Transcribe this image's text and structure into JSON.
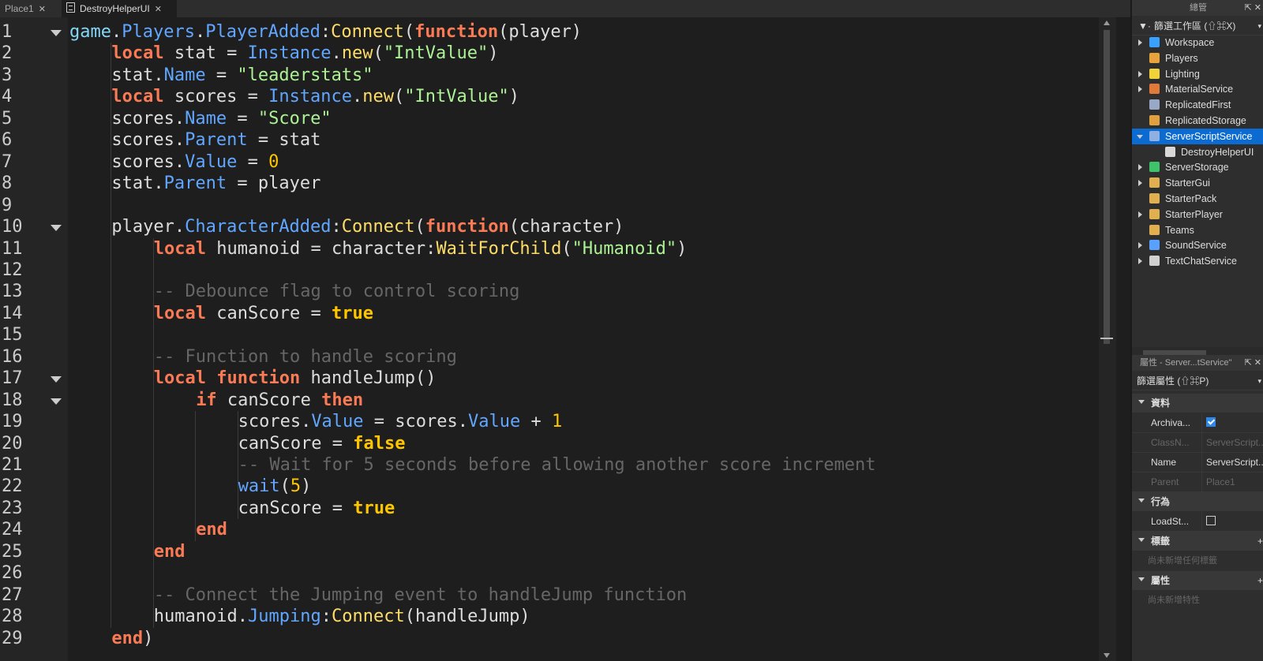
{
  "tabs": [
    {
      "label": "Place1",
      "active": false
    },
    {
      "label": "DestroyHelperUI",
      "active": true
    }
  ],
  "editor": {
    "line_numbers": [
      "1",
      "2",
      "3",
      "4",
      "5",
      "6",
      "7",
      "8",
      "9",
      "10",
      "11",
      "12",
      "13",
      "14",
      "15",
      "16",
      "17",
      "18",
      "19",
      "20",
      "21",
      "22",
      "23",
      "24",
      "25",
      "26",
      "27",
      "28",
      "29"
    ],
    "code": {
      "l1": [
        "game",
        ".",
        "Players",
        ".",
        "PlayerAdded",
        ":",
        "Connect",
        "(",
        "function",
        "(player)"
      ],
      "l2": [
        "local",
        " stat = ",
        "Instance",
        ".",
        "new",
        "(",
        "\"IntValue\"",
        ")"
      ],
      "l3": [
        "stat.",
        "Name",
        " = ",
        "\"leaderstats\""
      ],
      "l4": [
        "local",
        " scores = ",
        "Instance",
        ".",
        "new",
        "(",
        "\"IntValue\"",
        ")"
      ],
      "l5": [
        "scores.",
        "Name",
        " = ",
        "\"Score\""
      ],
      "l6": [
        "scores.",
        "Parent",
        " = stat"
      ],
      "l7": [
        "scores.",
        "Value",
        " = ",
        "0"
      ],
      "l8": [
        "stat.",
        "Parent",
        " = player"
      ],
      "l10": [
        "player.",
        "CharacterAdded",
        ":",
        "Connect",
        "(",
        "function",
        "(character)"
      ],
      "l11": [
        "local",
        " humanoid = character:",
        "WaitForChild",
        "(",
        "\"Humanoid\"",
        ")"
      ],
      "l13": [
        "-- Debounce flag to control scoring"
      ],
      "l14": [
        "local",
        " canScore = ",
        "true"
      ],
      "l16": [
        "-- Function to handle scoring"
      ],
      "l17": [
        "local",
        " ",
        "function",
        " handleJump()"
      ],
      "l18": [
        "if",
        " canScore ",
        "then"
      ],
      "l19": [
        "scores.",
        "Value",
        " = scores.",
        "Value",
        " + ",
        "1"
      ],
      "l20": [
        "canScore = ",
        "false"
      ],
      "l21": [
        "-- Wait for 5 seconds before allowing another score increment"
      ],
      "l22": [
        "wait",
        "(",
        "5",
        ")"
      ],
      "l23": [
        "canScore = ",
        "true"
      ],
      "l24": [
        "end"
      ],
      "l25": [
        "end"
      ],
      "l27": [
        "-- Connect the Jumping event to handleJump function"
      ],
      "l28": [
        "humanoid.",
        "Jumping",
        ":",
        "Connect",
        "(handleJump)"
      ],
      "l29": [
        "end",
        ")"
      ]
    }
  },
  "explorer": {
    "title": "總管",
    "filter": "篩選工作區 (⇧⌘X)",
    "items": [
      {
        "label": "Workspace",
        "color": "#3aa0ff"
      },
      {
        "label": "Players",
        "color": "#e8a33a"
      },
      {
        "label": "Lighting",
        "color": "#f2d23a"
      },
      {
        "label": "MaterialService",
        "color": "#e07a3a"
      },
      {
        "label": "ReplicatedFirst",
        "color": "#9aa8c8"
      },
      {
        "label": "ReplicatedStorage",
        "color": "#e0a040"
      },
      {
        "label": "ServerScriptService",
        "color": "#8fb0e0"
      },
      {
        "label": "DestroyHelperUI",
        "color": "#d8d8d8"
      },
      {
        "label": "ServerStorage",
        "color": "#3ec36a"
      },
      {
        "label": "StarterGui",
        "color": "#e0b050"
      },
      {
        "label": "StarterPack",
        "color": "#e0b050"
      },
      {
        "label": "StarterPlayer",
        "color": "#e0b050"
      },
      {
        "label": "Teams",
        "color": "#e0b050"
      },
      {
        "label": "SoundService",
        "color": "#5aa0ff"
      },
      {
        "label": "TextChatService",
        "color": "#d0d0d0"
      }
    ]
  },
  "properties": {
    "title": "屬性 - Server...tService\"",
    "filter": "篩選屬性 (⇧⌘P)",
    "sections": {
      "data": "資料",
      "behavior": "行為",
      "tags": "標籤",
      "attributes": "屬性"
    },
    "rows": {
      "archivable": {
        "name": "Archiva...",
        "checked": true
      },
      "classname": {
        "name": "ClassN...",
        "value": "ServerScript..."
      },
      "name": {
        "name": "Name",
        "value": "ServerScript..."
      },
      "parent": {
        "name": "Parent",
        "value": "Place1"
      },
      "loadstring": {
        "name": "LoadSt...",
        "checked": false
      }
    },
    "tags_empty": "尚未新增任何標籤",
    "attributes_empty": "尚未新增特性"
  }
}
